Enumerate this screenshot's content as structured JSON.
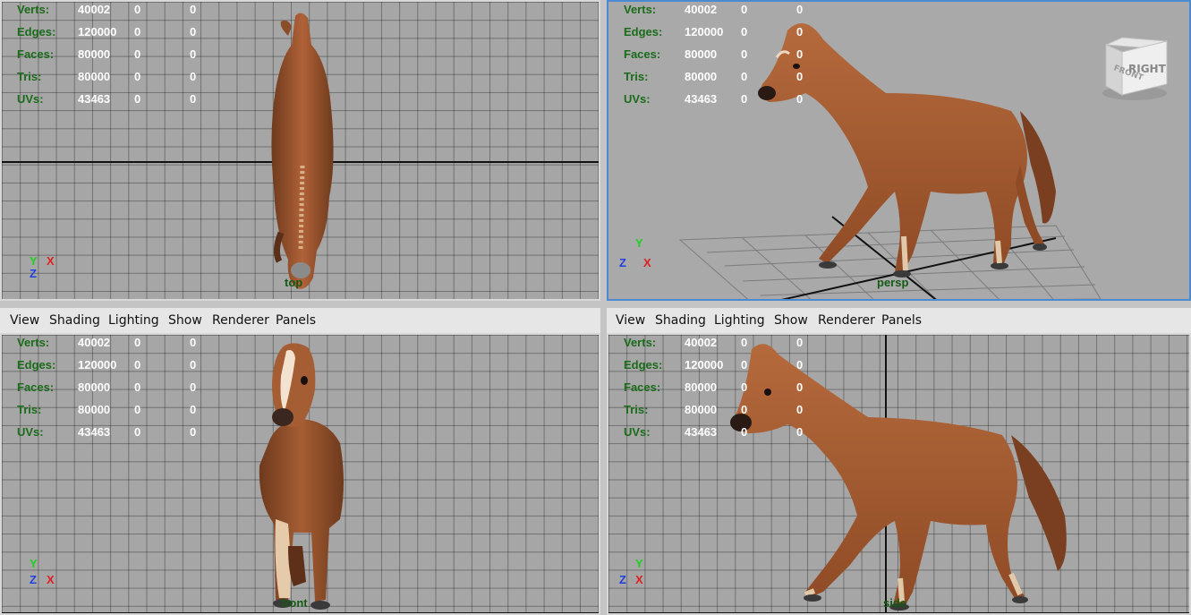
{
  "hud": {
    "labels": [
      "Verts:",
      "Edges:",
      "Faces:",
      "Tris:",
      "UVs:"
    ],
    "values": [
      "40002",
      "120000",
      "80000",
      "80000",
      "43463"
    ],
    "col2": [
      "0",
      "0",
      "0",
      "0",
      "0"
    ],
    "col3": [
      "0",
      "0",
      "0",
      "0",
      "0"
    ]
  },
  "menu": [
    "View",
    "Shading",
    "Lighting",
    "Show",
    "Renderer",
    "Panels"
  ],
  "cameras": {
    "top": "top",
    "persp": "persp",
    "front": "front",
    "side": "side"
  },
  "viewcube": {
    "front": "FRONT",
    "right": "RIGHT"
  },
  "axes": {
    "x": "X",
    "y": "Y",
    "z": "Z"
  },
  "colors": {
    "hud_label": "#1a6b1a",
    "axis_x": "#e02020",
    "axis_y": "#20d020",
    "axis_z": "#2040e0",
    "horse_coat": "#a4572f",
    "active_border": "#4a8ad2"
  }
}
